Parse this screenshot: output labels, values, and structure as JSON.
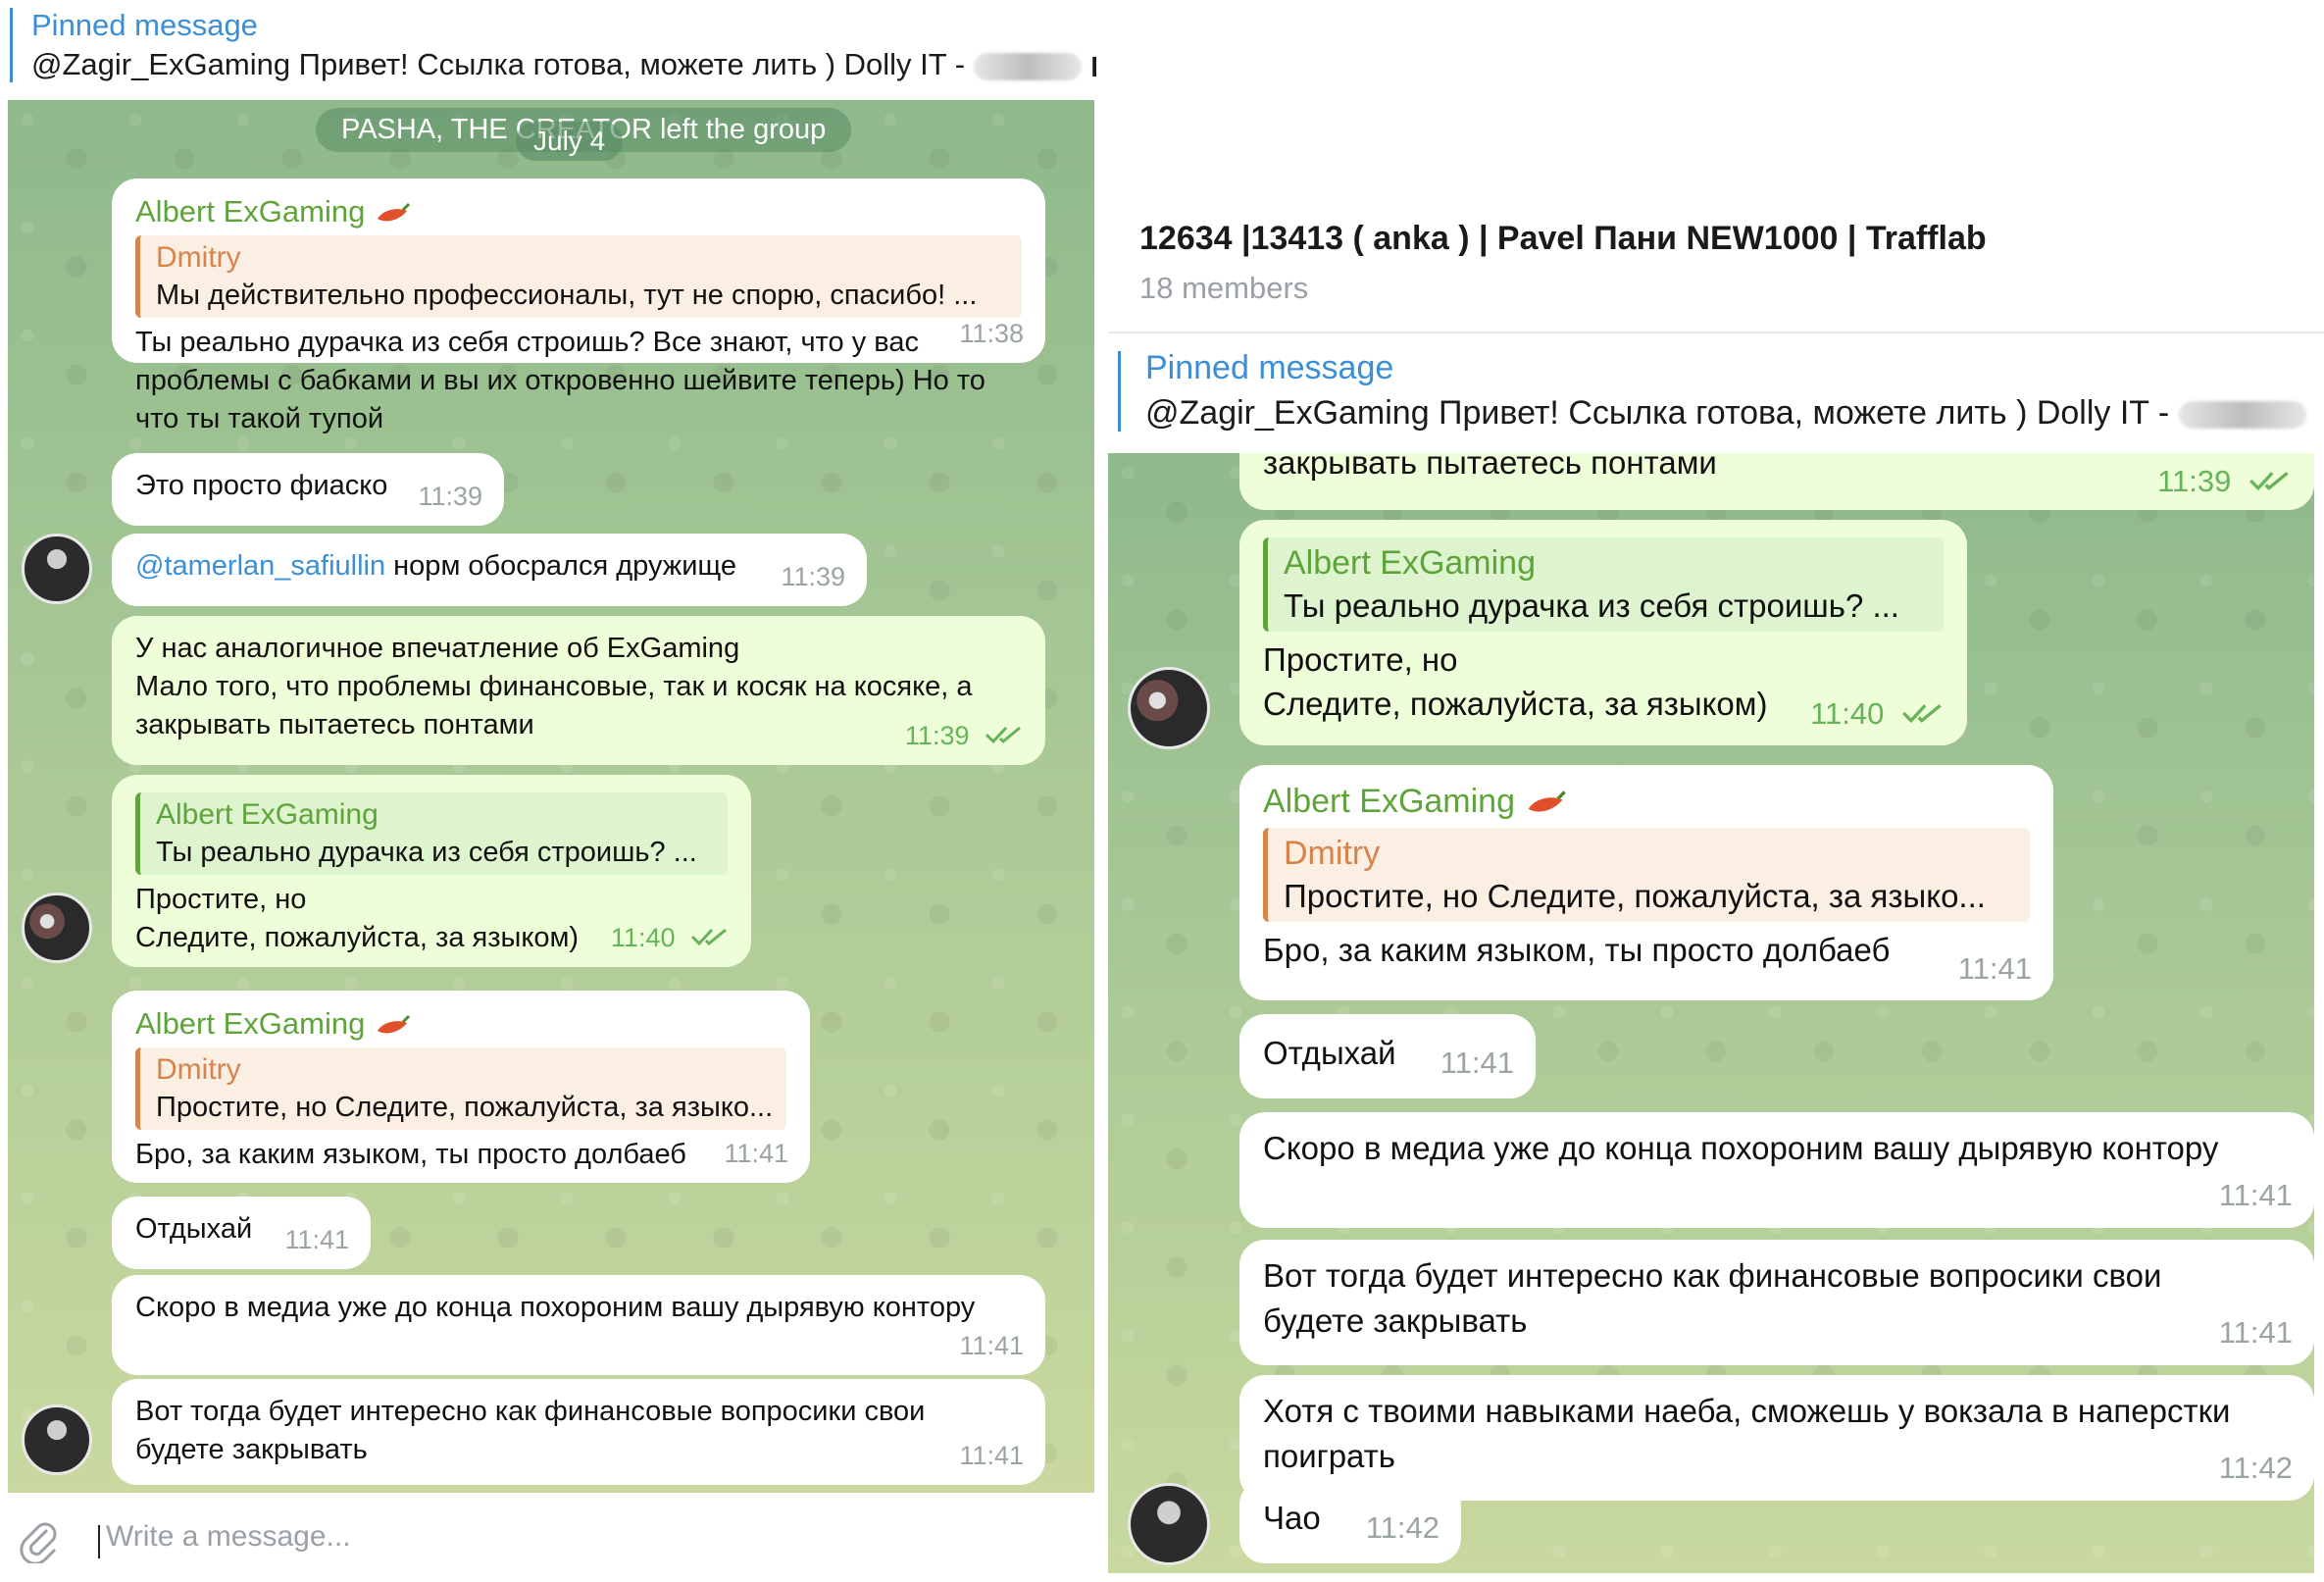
{
  "left": {
    "pinned_label": "Pinned message",
    "pinned_text": "@Zagir_ExGaming Привет! Ссылка готова, можете лить )   Dolly IT - ",
    "pinned_tail": " ◼ M",
    "service_msg": "PASHA, THE CREATOR left the group",
    "date": "July 4",
    "input_placeholder": "Write a message...",
    "messages": [
      {
        "sender": "Albert ExGaming",
        "quote_name": "Dmitry",
        "quote_text": "Мы действительно профессионалы, тут не спорю, спасибо! ...",
        "line1": "Ты реально дурачка из себя строишь? Все знают, что у вас",
        "line2": "проблемы с бабками и вы их откровенно шейвите теперь) Но то",
        "line3": "что ты такой тупой",
        "time": "11:38"
      },
      {
        "text": "Это просто фиаско",
        "time": "11:39"
      },
      {
        "mention": "@tamerlan_safiullin",
        "text": " норм обосрался дружище",
        "time": "11:39"
      },
      {
        "line1": "У нас аналогичное впечатление об ExGaming",
        "line2": "Мало того, что проблемы финансовые, так и косяк на косяке, а",
        "line3": "закрывать пытаетесь понтами",
        "time": "11:39"
      },
      {
        "quote_name": "Albert ExGaming",
        "quote_text": "Ты реально дурачка из себя строишь? ...",
        "line1": "Простите, но",
        "line2": "Следите, пожалуйста, за языком)",
        "time": "11:40"
      },
      {
        "sender": "Albert ExGaming",
        "quote_name": "Dmitry",
        "quote_text": "Простите, но Следите, пожалуйста, за языко...",
        "line1": "Бро, за каким языком, ты просто долбаеб",
        "time": "11:41"
      },
      {
        "text": "Отдыхай",
        "time": "11:41"
      },
      {
        "text": "Скоро в медиа уже до конца похороним вашу дырявую контору",
        "time": "11:41"
      },
      {
        "line1": "Вот тогда будет интересно как финансовые вопросики свои",
        "line2": "будете закрывать",
        "time": "11:41"
      }
    ]
  },
  "right": {
    "chat_title": "12634 |13413 ( anka ) | Pavel Пани NEW1000 | Trafflab",
    "members": "18 members",
    "pinned_label": "Pinned message",
    "pinned_text": "@Zagir_ExGaming Привет! Ссылка готова, можете лить )   Dolly IT - ",
    "messages": [
      {
        "line1": "закрывать пытаетесь понтами",
        "time": "11:39"
      },
      {
        "quote_name": "Albert ExGaming",
        "quote_text": "Ты реально дурачка из себя строишь? ...",
        "line1": "Простите, но",
        "line2": "Следите, пожалуйста, за языком)",
        "time": "11:40"
      },
      {
        "sender": "Albert ExGaming",
        "quote_name": "Dmitry",
        "quote_text": "Простите, но Следите, пожалуйста, за языко...",
        "line1": "Бро, за каким языком, ты просто долбаеб",
        "time": "11:41"
      },
      {
        "text": "Отдыхай",
        "time": "11:41"
      },
      {
        "text": "Скоро в медиа уже до конца похороним вашу дырявую контору",
        "time": "11:41"
      },
      {
        "line1": "Вот тогда будет интересно как финансовые вопросики свои",
        "line2": "будете закрывать",
        "time": "11:41"
      },
      {
        "line1": "Хотя с твоими навыками наеба, сможешь у вокзала в наперстки",
        "line2": "поиграть",
        "time": "11:42"
      },
      {
        "text": "Чао",
        "time": "11:42"
      }
    ]
  },
  "icons": {
    "read_ticks": "double-check-icon",
    "attach": "paperclip-icon",
    "emoji": "chili-emoji-icon"
  },
  "colors": {
    "accent_blue": "#3a8fd6",
    "sender_green": "#5fa43a",
    "quote_orange": "#d6844a",
    "outgoing_bubble": "#eefed9"
  }
}
